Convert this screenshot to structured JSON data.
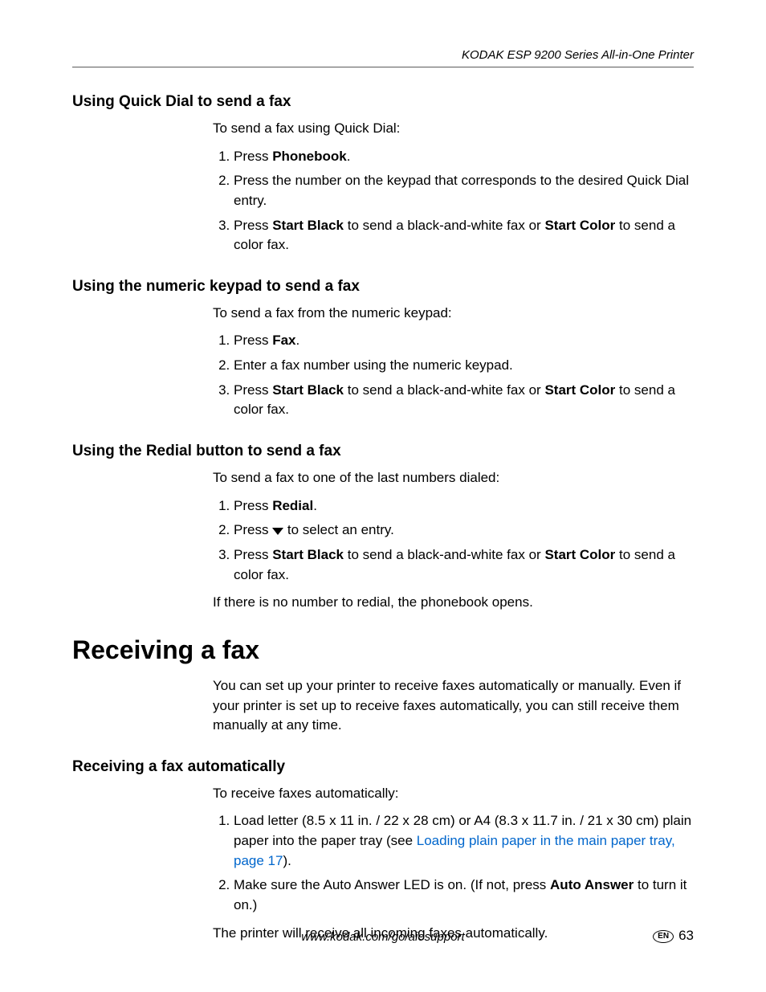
{
  "running_head": "KODAK ESP 9200 Series All-in-One Printer",
  "sections": {
    "quick_dial": {
      "heading": "Using Quick Dial to send a fax",
      "intro": "To send a fax using Quick Dial:",
      "li1_a": "Press ",
      "li1_b": "Phonebook",
      "li1_c": ".",
      "li2": "Press the number on the keypad that corresponds to the desired Quick Dial entry.",
      "li3_a": "Press ",
      "li3_b": "Start Black",
      "li3_c": " to send a black-and-white fax or ",
      "li3_d": "Start Color",
      "li3_e": " to send a color fax."
    },
    "numeric": {
      "heading": "Using the numeric keypad to send a fax",
      "intro": "To send a fax from the numeric keypad:",
      "li1_a": "Press ",
      "li1_b": "Fax",
      "li1_c": ".",
      "li2": "Enter a fax number using the numeric keypad.",
      "li3_a": "Press ",
      "li3_b": "Start Black",
      "li3_c": " to send a black-and-white fax or ",
      "li3_d": "Start Color",
      "li3_e": " to send a color fax."
    },
    "redial": {
      "heading": "Using the Redial button to send a fax",
      "intro": "To send a fax to one of the last numbers dialed:",
      "li1_a": "Press ",
      "li1_b": "Redial",
      "li1_c": ".",
      "li2_a": "Press ",
      "li2_c": " to select an entry.",
      "li3_a": "Press ",
      "li3_b": "Start Black",
      "li3_c": " to send a black-and-white fax or ",
      "li3_d": "Start Color",
      "li3_e": " to send a color fax.",
      "note": "If there is no number to redial, the phonebook opens."
    },
    "receiving": {
      "heading": "Receiving a fax",
      "intro": "You can set up your printer to receive faxes automatically or manually. Even if your printer is set up to receive faxes automatically, you can still receive them manually at any time."
    },
    "auto": {
      "heading": "Receiving a fax automatically",
      "intro": "To receive faxes automatically:",
      "li1_a": "Load letter (8.5 x 11 in. / 22 x 28 cm) or A4 (8.3 x 11.7 in. / 21 x 30 cm) plain paper into the paper tray (see ",
      "li1_link": "Loading plain paper in the main paper tray, page 17",
      "li1_c": ").",
      "li2_a": "Make sure the Auto Answer LED is on. (If not, press ",
      "li2_b": "Auto Answer",
      "li2_c": " to turn it on.)",
      "note": "The printer will receive all incoming faxes automatically."
    }
  },
  "footer": {
    "url": "www.kodak.com/go/aiosupport",
    "lang": "EN",
    "page": "63"
  }
}
